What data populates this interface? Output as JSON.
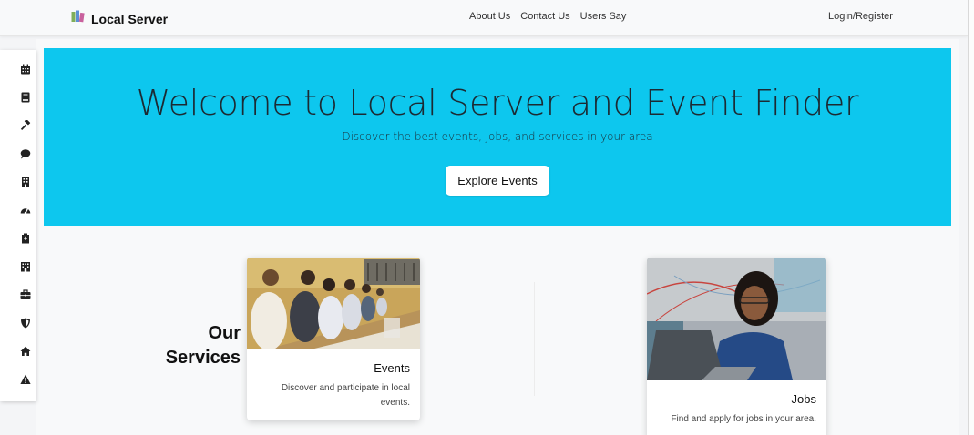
{
  "navbar": {
    "brand": "Local Server",
    "links": [
      "About Us",
      "Contact Us",
      "Users Say"
    ],
    "login": "Login/Register"
  },
  "sidebar": {
    "icons": [
      "calendar-icon",
      "book-icon",
      "gavel-icon",
      "chat-icon",
      "building-icon",
      "gauge-icon",
      "hospital-icon",
      "city-icon",
      "briefcase-icon",
      "shield-icon",
      "home-icon",
      "warning-icon"
    ]
  },
  "hero": {
    "title": "Welcome to Local Server and Event Finder",
    "subtitle": "Discover the best events, jobs, and services in your area",
    "button": "Explore Events"
  },
  "services": {
    "heading_line1": "Our",
    "heading_line2": "Services",
    "cards": [
      {
        "title": "Events",
        "text": "Discover and participate in local events."
      },
      {
        "title": "Jobs",
        "text": "Find and apply for jobs in your area."
      }
    ]
  },
  "colors": {
    "hero": "#0dc7ee",
    "navbar": "#f8f9fa",
    "card": "#ffffff"
  }
}
